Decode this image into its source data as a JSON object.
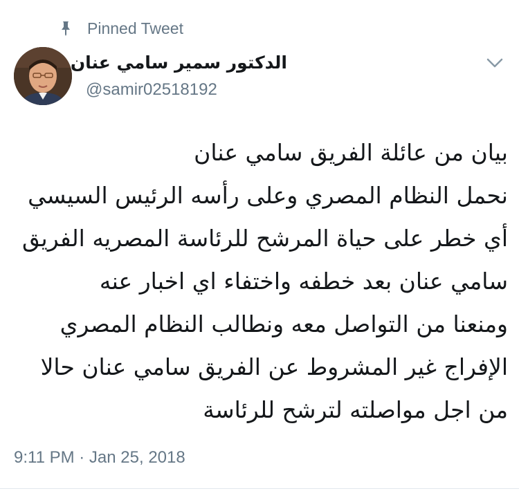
{
  "pinned": {
    "icon": "pin-icon",
    "label": "Pinned Tweet"
  },
  "author": {
    "display_name": "الدكتور سمير سامي عنان",
    "handle": "@samir02518192",
    "avatar_icon": "profile-photo"
  },
  "menu": {
    "icon": "chevron-down-icon"
  },
  "tweet": {
    "lines": [
      "بيان من عائلة الفريق سامي عنان",
      "نحمل النظام المصري وعلى رأسه الرئيس السيسي",
      "أي خطر على حياة المرشح للرئاسة المصريه الفريق",
      "سامي عنان بعد خطفه واختفاء اي اخبار عنه",
      "ومنعنا من التواصل معه ونطالب النظام المصري",
      "الإفراج غير المشروط عن الفريق سامي عنان حالا",
      "من اجل مواصلته لترشح للرئاسة"
    ],
    "timestamp": "9:11 PM · Jan 25, 2018"
  },
  "colors": {
    "text_primary": "#14171a",
    "text_secondary": "#657786",
    "divider": "#e1e8ed"
  }
}
